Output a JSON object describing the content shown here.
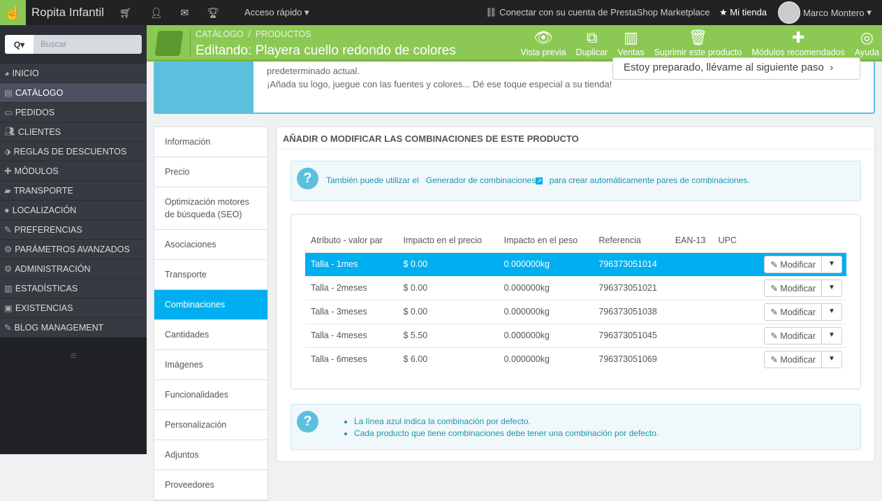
{
  "topbar": {
    "shop_name": "Ropita Infantil",
    "quick_access": "Acceso rápido",
    "connect": "Conectar con su cuenta de PrestaShop Marketplace",
    "my_store": "Mi tienda",
    "user": "Marco Montero"
  },
  "sidebar": {
    "search_placeholder": "Buscar",
    "items": [
      {
        "label": "INICIO",
        "icon": "dashboard-icon"
      },
      {
        "label": "CATÁLOGO",
        "icon": "book-icon"
      },
      {
        "label": "PEDIDOS",
        "icon": "credit-card-icon"
      },
      {
        "label": "CLIENTES",
        "icon": "users-icon"
      },
      {
        "label": "REGLAS DE DESCUENTOS",
        "icon": "tags-icon"
      },
      {
        "label": "MÓDULOS",
        "icon": "puzzle-icon"
      },
      {
        "label": "TRANSPORTE",
        "icon": "truck-icon"
      },
      {
        "label": "LOCALIZACIÓN",
        "icon": "globe-icon"
      },
      {
        "label": "PREFERENCIAS",
        "icon": "wrench-icon"
      },
      {
        "label": "PARÁMETROS AVANZADOS",
        "icon": "cogs-icon"
      },
      {
        "label": "ADMINISTRACIÓN",
        "icon": "cog-icon"
      },
      {
        "label": "ESTADÍSTICAS",
        "icon": "bar-chart-icon"
      },
      {
        "label": "EXISTENCIAS",
        "icon": "archive-icon"
      },
      {
        "label": "BLOG MANAGEMENT",
        "icon": "pencil-icon"
      }
    ]
  },
  "header": {
    "crumb1": "CATÁLOGO",
    "crumb_sep": "/",
    "crumb2": "PRODUCTOS",
    "title": "Editando: Playera cuello redondo de colores",
    "toolbar": [
      "Vista previa",
      "Duplicar",
      "Ventas",
      "Suprimir este producto",
      "Módulos recomendados",
      "Ayuda"
    ]
  },
  "welcome": {
    "line1": "predeterminado actual.",
    "line2": "¡Añada su logo, juegue con las fuentes y colores... Dé ese toque especial a su tienda!",
    "next": "Estoy preparado, llévame al siguiente paso"
  },
  "tabs": [
    "Información",
    "Precio",
    "Optimización motores de búsqueda (SEO)",
    "Asociaciones",
    "Transporte",
    "Combinaciones",
    "Cantidades",
    "Imágenes",
    "Funcionalidades",
    "Personalización",
    "Adjuntos",
    "Proveedores"
  ],
  "panel": {
    "title": "AÑADIR O MODIFICAR LAS COMBINACIONES DE ESTE PRODUCTO",
    "info_pre": "También puede utilizar el",
    "info_link": "Generador de combinaciones",
    "info_post": "para crear automáticamente pares de combinaciones.",
    "columns": [
      "Atributo - valor par",
      "Impacto en el precio",
      "Impacto en el peso",
      "Referencia",
      "EAN-13",
      "UPC"
    ],
    "rows": [
      [
        "Talla - 1mes",
        "$ 0.00",
        "0.000000kg",
        "796373051014",
        "",
        ""
      ],
      [
        "Talla - 2meses",
        "$ 0.00",
        "0.000000kg",
        "796373051021",
        "",
        ""
      ],
      [
        "Talla - 3meses",
        "$ 0.00",
        "0.000000kg",
        "796373051038",
        "",
        ""
      ],
      [
        "Talla - 4meses",
        "$ 5.50",
        "0.000000kg",
        "796373051045",
        "",
        ""
      ],
      [
        "Talla - 6meses",
        "$ 6.00",
        "0.000000kg",
        "796373051069",
        "",
        ""
      ]
    ],
    "modify": "Modificar",
    "notes": [
      "La línea azul indica la combinación por defecto.",
      "Cada producto que tiene combinaciones debe tener una combinación por defecto."
    ]
  }
}
